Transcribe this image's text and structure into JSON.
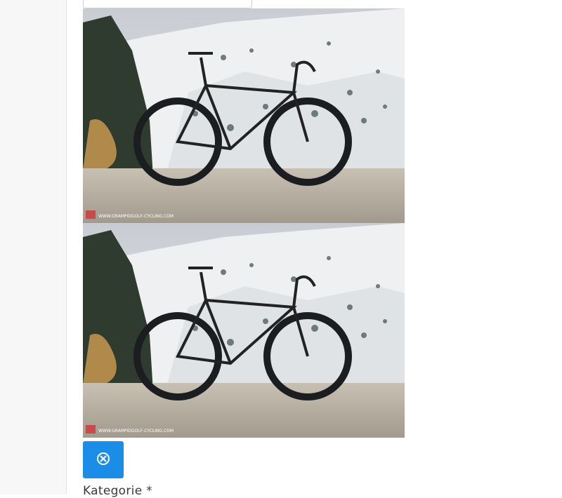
{
  "images": [
    {
      "alt": "Bike photo",
      "watermark": "WWW.GRAMPIDGOLF-CYCLING.COM"
    },
    {
      "alt": "Bike photo",
      "watermark": "WWW.GRAMPIDGOLF-CYCLING.COM"
    }
  ],
  "remove_button": {
    "icon": "close-circle-icon",
    "color": "#1a8ee6"
  },
  "category_field": {
    "label": "Kategorie *"
  }
}
